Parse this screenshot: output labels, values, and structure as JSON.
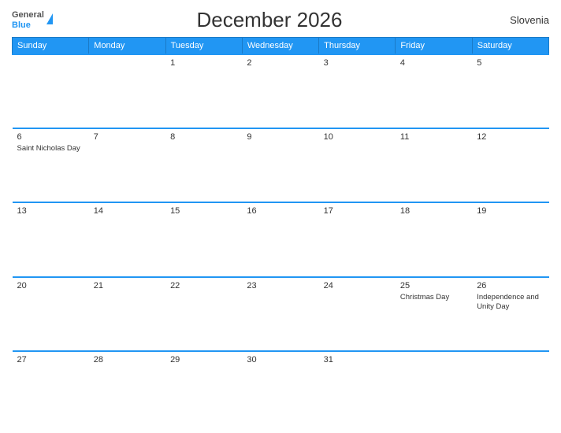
{
  "header": {
    "logo_general": "General",
    "logo_blue": "Blue",
    "title": "December 2026",
    "country": "Slovenia"
  },
  "weekdays": [
    "Sunday",
    "Monday",
    "Tuesday",
    "Wednesday",
    "Thursday",
    "Friday",
    "Saturday"
  ],
  "weeks": [
    [
      {
        "day": "",
        "event": ""
      },
      {
        "day": "",
        "event": ""
      },
      {
        "day": "1",
        "event": ""
      },
      {
        "day": "2",
        "event": ""
      },
      {
        "day": "3",
        "event": ""
      },
      {
        "day": "4",
        "event": ""
      },
      {
        "day": "5",
        "event": ""
      }
    ],
    [
      {
        "day": "6",
        "event": "Saint Nicholas Day"
      },
      {
        "day": "7",
        "event": ""
      },
      {
        "day": "8",
        "event": ""
      },
      {
        "day": "9",
        "event": ""
      },
      {
        "day": "10",
        "event": ""
      },
      {
        "day": "11",
        "event": ""
      },
      {
        "day": "12",
        "event": ""
      }
    ],
    [
      {
        "day": "13",
        "event": ""
      },
      {
        "day": "14",
        "event": ""
      },
      {
        "day": "15",
        "event": ""
      },
      {
        "day": "16",
        "event": ""
      },
      {
        "day": "17",
        "event": ""
      },
      {
        "day": "18",
        "event": ""
      },
      {
        "day": "19",
        "event": ""
      }
    ],
    [
      {
        "day": "20",
        "event": ""
      },
      {
        "day": "21",
        "event": ""
      },
      {
        "day": "22",
        "event": ""
      },
      {
        "day": "23",
        "event": ""
      },
      {
        "day": "24",
        "event": ""
      },
      {
        "day": "25",
        "event": "Christmas Day"
      },
      {
        "day": "26",
        "event": "Independence and Unity Day"
      }
    ],
    [
      {
        "day": "27",
        "event": ""
      },
      {
        "day": "28",
        "event": ""
      },
      {
        "day": "29",
        "event": ""
      },
      {
        "day": "30",
        "event": ""
      },
      {
        "day": "31",
        "event": ""
      },
      {
        "day": "",
        "event": ""
      },
      {
        "day": "",
        "event": ""
      }
    ]
  ]
}
